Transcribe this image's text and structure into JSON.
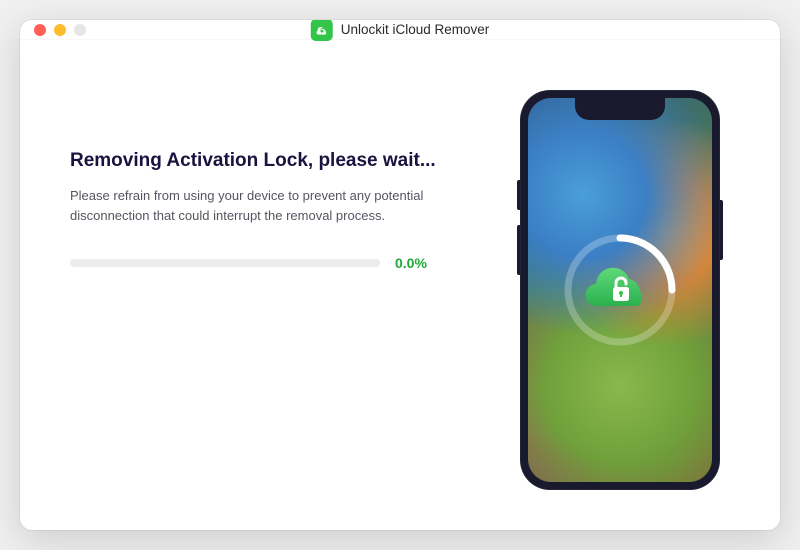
{
  "titlebar": {
    "app_name": "Unlockit iCloud Remover"
  },
  "main": {
    "heading": "Removing Activation Lock, please wait...",
    "subtext": "Please refrain from using your device to prevent any potential disconnection that could interrupt the removal process.",
    "progress_percent_text": "0.0%",
    "progress_percent_value": 0
  },
  "colors": {
    "accent_green": "#33c548",
    "progress_text": "#1ea936",
    "heading_dark": "#1a1340"
  },
  "icons": {
    "app_icon": "cloud-unlock-icon",
    "phone_center": "cloud-unlock-icon"
  }
}
